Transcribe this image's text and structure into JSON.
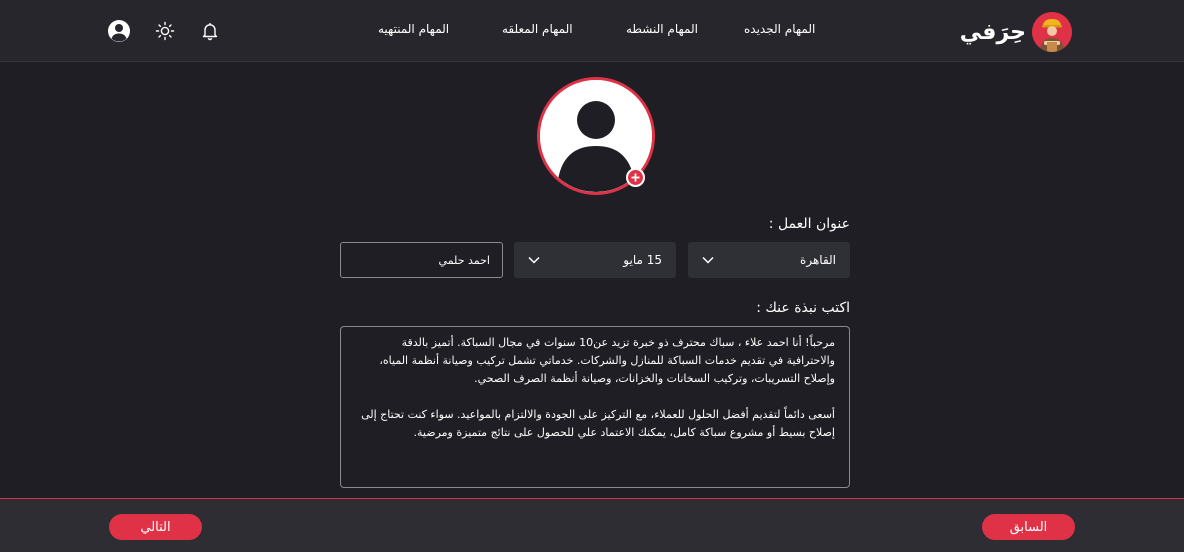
{
  "header": {
    "brand": "حِرَفي",
    "nav": [
      "المهام الجديده",
      "المهام النشطه",
      "المهام المعلقه",
      "المهام المنتهيه"
    ]
  },
  "form": {
    "work_address_label": "عنوان العمل :",
    "city": "القاهرة",
    "district": "15 مايو",
    "name": "احمد حلمي",
    "bio_label": "اكتب نبذة عنك :",
    "bio_paragraphs": [
      "مرحباً! أنا احمد علاء ، سباك محترف ذو خبرة تزيد عن10 سنوات في مجال السباكة. أتميز بالدقة والاحترافية في تقديم خدمات السباكة للمنازل والشركات. خدماتي تشمل تركيب وصيانة أنظمة المياه، وإصلاح التسريبات، وتركيب السخانات والخزانات، وصيانة أنظمة الصرف الصحي.",
      "أسعى دائماً لتقديم أفضل الحلول للعملاء، مع التركيز على الجودة والالتزام بالمواعيد. سواء كنت تحتاج إلى إصلاح بسيط أو مشروع سباكة كامل، يمكنك الاعتماد علي للحصول على نتائج متميزة ومرضية."
    ]
  },
  "footer": {
    "next": "التالي",
    "previous": "السابق"
  },
  "colors": {
    "accent": "#e03247",
    "background": "#1e1e24",
    "header": "#26262c",
    "field": "#2f2f36"
  },
  "icons": [
    "user-circle-icon",
    "sun-icon",
    "bell-icon",
    "chevron-down-icon",
    "plus-icon"
  ]
}
